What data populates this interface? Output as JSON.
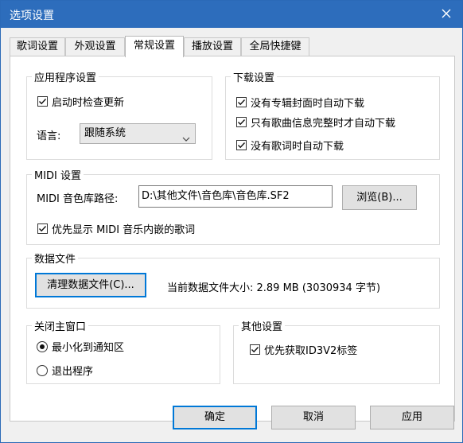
{
  "window": {
    "title": "选项设置"
  },
  "tabs": [
    {
      "label": "歌词设置",
      "active": false
    },
    {
      "label": "外观设置",
      "active": false
    },
    {
      "label": "常规设置",
      "active": true
    },
    {
      "label": "播放设置",
      "active": false
    },
    {
      "label": "全局快捷键",
      "active": false
    }
  ],
  "app_settings": {
    "legend": "应用程序设置",
    "check_update_label": "启动时检查更新",
    "check_update_checked": true,
    "language_label": "语言:",
    "language_value": "跟随系统"
  },
  "download_settings": {
    "legend": "下载设置",
    "options": [
      {
        "label": "没有专辑封面时自动下载",
        "checked": true
      },
      {
        "label": "只有歌曲信息完整时才自动下载",
        "checked": true
      },
      {
        "label": "没有歌词时自动下载",
        "checked": true
      }
    ]
  },
  "midi": {
    "legend": "MIDI 设置",
    "path_label": "MIDI 音色库路径:",
    "path_value": "D:\\其他文件\\音色库\\音色库.SF2",
    "browse_label": "浏览(B)...",
    "show_lyrics_label": "优先显示 MIDI 音乐内嵌的歌词",
    "show_lyrics_checked": true
  },
  "data_file": {
    "legend": "数据文件",
    "clear_label": "清理数据文件(C)...",
    "size_text": "当前数据文件大小: 2.89 MB (3030934 字节)"
  },
  "close_window": {
    "legend": "关闭主窗口",
    "options": [
      {
        "label": "最小化到通知区",
        "selected": true
      },
      {
        "label": "退出程序",
        "selected": false
      }
    ]
  },
  "other": {
    "legend": "其他设置",
    "id3_label": "优先获取ID3V2标签",
    "id3_checked": true
  },
  "footer": {
    "ok_label": "确定",
    "cancel_label": "取消",
    "apply_label": "应用"
  }
}
